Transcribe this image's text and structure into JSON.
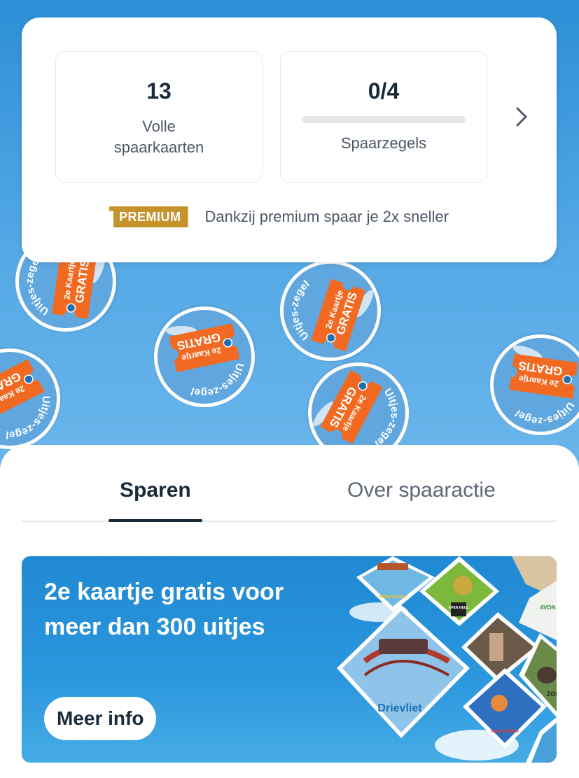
{
  "stats": {
    "full_cards_value": "13",
    "full_cards_label": "Volle spaarkaarten",
    "stamps_value": "0/4",
    "stamps_label": "Spaarzegels",
    "stamps_progress": 0
  },
  "premium": {
    "badge": "PREMIUM",
    "text": "Dankzij premium spaar je 2x sneller"
  },
  "stamp_art": {
    "ring_text": "Uitjes-zegel",
    "ticket_line1": "2e Kaartje",
    "ticket_line2": "GRATIS"
  },
  "tabs": [
    {
      "label": "Sparen",
      "active": true
    },
    {
      "label": "Over spaaractie",
      "active": false
    }
  ],
  "promo": {
    "title": "2e kaartje gratis voor meer dan 300 uitjes",
    "button": "Meer info",
    "logos": {
      "drievliet": "Drievliet",
      "apenheul": "APEN HEUL",
      "avonturenpark": "AVON",
      "zoo": "ZOO",
      "madurodam": "madurodam",
      "hellendoorn": "Hellendoorn"
    }
  },
  "colors": {
    "sky": "#3d9ee0",
    "ticket": "#f26a21",
    "premium": "#c5922c",
    "text_dark": "#1b2a3a",
    "progress": "#00a0e2"
  }
}
